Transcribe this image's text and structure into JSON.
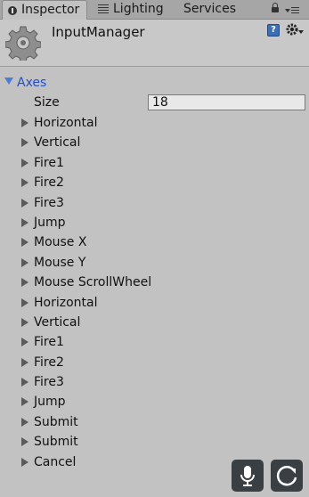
{
  "tabs": {
    "inspector": "Inspector",
    "lighting": "Lighting",
    "services": "Services"
  },
  "header": {
    "title": "InputManager",
    "help_glyph": "?"
  },
  "axes": {
    "label": "Axes",
    "size_label": "Size",
    "size_value": "18",
    "items": [
      "Horizontal",
      "Vertical",
      "Fire1",
      "Fire2",
      "Fire3",
      "Jump",
      "Mouse X",
      "Mouse Y",
      "Mouse ScrollWheel",
      "Horizontal",
      "Vertical",
      "Fire1",
      "Fire2",
      "Fire3",
      "Jump",
      "Submit",
      "Submit",
      "Cancel"
    ]
  },
  "icons": {
    "inspector_tab": "info-icon",
    "lighting_tab": "lighting-icon",
    "lock": "lock-icon",
    "menu": "menu-icon",
    "component": "gear-icon",
    "help": "help-icon",
    "settings": "settings-icon",
    "mic": "microphone-icon",
    "refresh": "refresh-icon"
  },
  "colors": {
    "accent": "#1f4fc9",
    "panel": "#c2c2c2",
    "fab": "#3a3f44"
  }
}
